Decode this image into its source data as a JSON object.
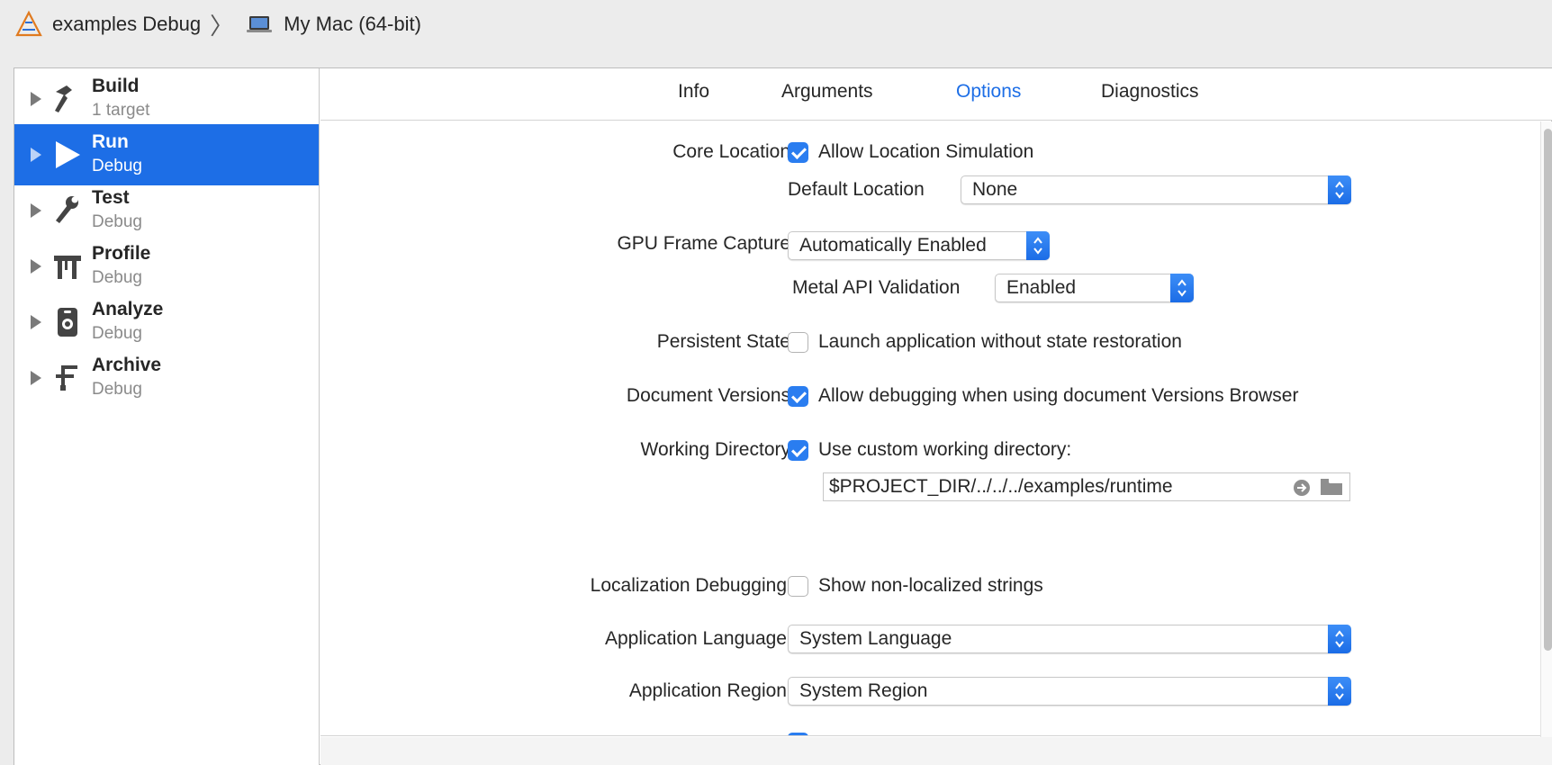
{
  "breadcrumb": {
    "scheme": "examples Debug",
    "destination": "My Mac (64-bit)",
    "icons": [
      "xcode-app-icon",
      "laptop-icon"
    ]
  },
  "sidebar": {
    "items": [
      {
        "title": "Build",
        "subtitle": "1 target",
        "icon": "hammer-icon"
      },
      {
        "title": "Run",
        "subtitle": "Debug",
        "icon": "play-icon",
        "selected": true
      },
      {
        "title": "Test",
        "subtitle": "Debug",
        "icon": "wrench-icon"
      },
      {
        "title": "Profile",
        "subtitle": "Debug",
        "icon": "instruments-icon"
      },
      {
        "title": "Analyze",
        "subtitle": "Debug",
        "icon": "analyze-icon"
      },
      {
        "title": "Archive",
        "subtitle": "Debug",
        "icon": "archive-icon"
      }
    ]
  },
  "tabs": [
    {
      "label": "Info"
    },
    {
      "label": "Arguments"
    },
    {
      "label": "Options",
      "active": true
    },
    {
      "label": "Diagnostics"
    }
  ],
  "options": {
    "core_location": {
      "label": "Core Location",
      "checkbox_label": "Allow Location Simulation",
      "checked": true,
      "default_location_label": "Default Location",
      "default_location_value": "None"
    },
    "gpu_frame_capture": {
      "label": "GPU Frame Capture",
      "value": "Automatically Enabled",
      "metal_label": "Metal API Validation",
      "metal_value": "Enabled"
    },
    "persistent_state": {
      "label": "Persistent State",
      "checkbox_label": "Launch application without state restoration",
      "checked": false
    },
    "document_versions": {
      "label": "Document Versions",
      "checkbox_label": "Allow debugging when using document Versions Browser",
      "checked": true
    },
    "working_directory": {
      "label": "Working Directory",
      "checkbox_label": "Use custom working directory:",
      "checked": true,
      "path": "$PROJECT_DIR/../../../examples/runtime"
    },
    "localization_debugging": {
      "label": "Localization Debugging",
      "checkbox_label": "Show non-localized strings",
      "checked": false
    },
    "application_language": {
      "label": "Application Language",
      "value": "System Language"
    },
    "application_region": {
      "label": "Application Region",
      "value": "System Region"
    }
  },
  "colors": {
    "accent": "#1d6ee6",
    "checkbox_on": "#2a7df0"
  }
}
